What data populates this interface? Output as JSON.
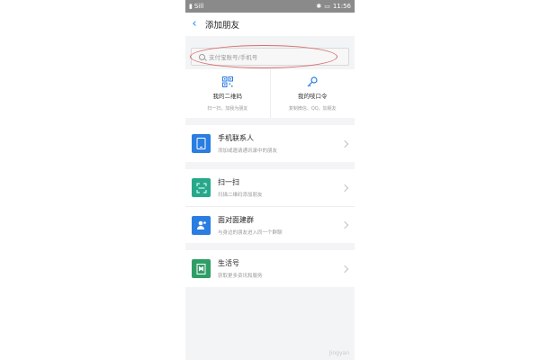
{
  "statusbar": {
    "signal": "Sill",
    "time": "11:56"
  },
  "navbar": {
    "title": "添加朋友"
  },
  "search": {
    "placeholder": "支付宝账号/手机号"
  },
  "quick_actions": [
    {
      "title": "我的二维码",
      "subtitle": "扫一扫，加我为朋友"
    },
    {
      "title": "我的吱口令",
      "subtitle": "复制微信、QQ，加朋友"
    }
  ],
  "groups": [
    {
      "rows": [
        {
          "title": "手机联系人",
          "desc": "添加或邀请通讯录中的朋友",
          "icon": "phone-icon",
          "color": "#2a7de1"
        }
      ]
    },
    {
      "rows": [
        {
          "title": "扫一扫",
          "desc": "扫描二维码添加朋友",
          "icon": "scan-icon",
          "color": "#26a98b"
        },
        {
          "title": "面对面建群",
          "desc": "与身边的朋友进入同一个群聊",
          "icon": "group-icon",
          "color": "#2a7de1"
        }
      ]
    },
    {
      "rows": [
        {
          "title": "生活号",
          "desc": "获取更多资讯和服务",
          "icon": "bookmark-icon",
          "color": "#2f9e66"
        }
      ]
    }
  ],
  "watermark": "Jingyan"
}
